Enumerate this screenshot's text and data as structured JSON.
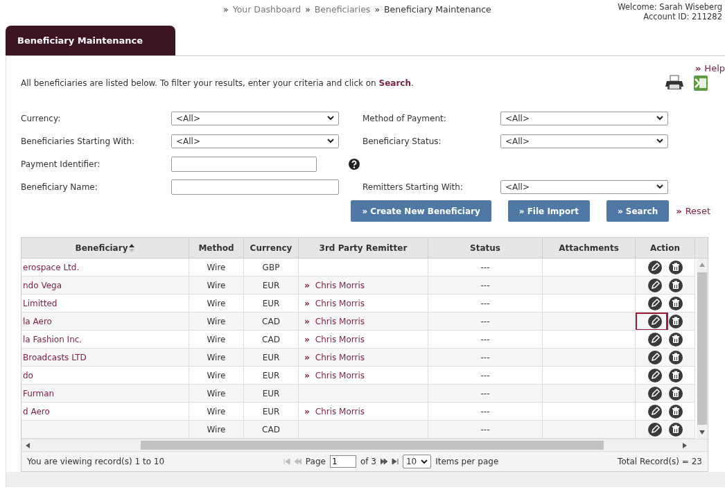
{
  "breadcrumbs": [
    {
      "separator": "»",
      "label": "Your Dashboard",
      "current": false
    },
    {
      "separator": "»",
      "label": "Beneficiaries",
      "current": false
    },
    {
      "separator": "»",
      "label": "Beneficiary Maintenance",
      "current": true
    }
  ],
  "user": {
    "welcome": "Welcome: Sarah Wiseberg",
    "account": "Account ID: 211282"
  },
  "tab": {
    "label": "Beneficiary Maintenance",
    "selected": true
  },
  "help_link": {
    "marker": "»",
    "label": "Help"
  },
  "intro": "All beneficiaries are listed below. To filter your results, enter your criteria and click on **Search**.",
  "filter_rows": [
    [
      {
        "kind": "select",
        "label": "Currency:",
        "value": "<All>"
      },
      {
        "kind": "select",
        "label": "Method of Payment:",
        "value": "<All>"
      }
    ],
    [
      {
        "kind": "select",
        "label": "Beneficiaries Starting With:",
        "value": "<All>"
      },
      {
        "kind": "select",
        "label": "Beneficiary Status:",
        "value": "<All>"
      }
    ],
    [
      {
        "kind": "text_help",
        "label": "Payment Identifier:"
      }
    ],
    [
      {
        "kind": "text",
        "label": "Beneficiary Name:"
      },
      {
        "kind": "select",
        "label": "Remitters Starting With:",
        "value": "<All>"
      }
    ]
  ],
  "buttons": [
    {
      "label": "» Create New Beneficiary"
    },
    {
      "label": "» File Import"
    },
    {
      "label": "» Search"
    }
  ],
  "reset_link": {
    "marker": "»",
    "label": "Reset"
  },
  "table": {
    "columns": [
      {
        "label": "Beneficiary",
        "sort_ascending": true
      },
      {
        "label": "Method"
      },
      {
        "label": "Currency"
      },
      {
        "label": "3rd Party Remitter"
      },
      {
        "label": "Status"
      },
      {
        "label": "Attachments"
      },
      {
        "label": "Action"
      }
    ],
    "rows": [
      {
        "beneficiary": "erospace Ltd.",
        "method": "Wire",
        "currency": "GBP",
        "status": "---",
        "edit_highlighted": false
      },
      {
        "beneficiary": "ndo Vega",
        "method": "Wire",
        "currency": "EUR",
        "remitter": {
          "marker": "»",
          "name": "Chris Morris"
        },
        "status": "---",
        "edit_highlighted": false
      },
      {
        "beneficiary": "Limitted",
        "method": "Wire",
        "currency": "EUR",
        "remitter": {
          "marker": "»",
          "name": "Chris Morris"
        },
        "status": "---",
        "edit_highlighted": false
      },
      {
        "beneficiary": "la Aero",
        "method": "Wire",
        "currency": "CAD",
        "remitter": {
          "marker": "»",
          "name": "Chris Morris"
        },
        "status": "---",
        "edit_highlighted": true
      },
      {
        "beneficiary": "la Fashion Inc.",
        "method": "Wire",
        "currency": "CAD",
        "remitter": {
          "marker": "»",
          "name": "Chris Morris"
        },
        "status": "---",
        "edit_highlighted": false
      },
      {
        "beneficiary": "Broadcasts LTD",
        "method": "Wire",
        "currency": "EUR",
        "remitter": {
          "marker": "»",
          "name": "Chris Morris"
        },
        "status": "---",
        "edit_highlighted": false
      },
      {
        "beneficiary": "do",
        "method": "Wire",
        "currency": "EUR",
        "remitter": {
          "marker": "»",
          "name": "Chris Morris"
        },
        "status": "---",
        "edit_highlighted": false
      },
      {
        "beneficiary": "Furman",
        "method": "Wire",
        "currency": "EUR",
        "status": "---",
        "edit_highlighted": false
      },
      {
        "beneficiary": "d Aero",
        "method": "Wire",
        "currency": "EUR",
        "remitter": {
          "marker": "»",
          "name": "Chris Morris"
        },
        "status": "---",
        "edit_highlighted": false
      },
      {
        "method": "Wire",
        "currency": "CAD",
        "status": "---",
        "edit_highlighted": false
      }
    ]
  },
  "footer": {
    "viewing": "You are viewing record(s) 1 to 10",
    "nav": [
      {
        "kind": "first",
        "disabled": true
      },
      {
        "kind": "prev",
        "disabled": true
      },
      {
        "kind": "next",
        "disabled": false
      },
      {
        "kind": "last",
        "disabled": false
      }
    ],
    "page_label": "Page",
    "page_value": "1",
    "of_label": "of 3",
    "page_size": "10",
    "page_size_label": "Items per page",
    "total": "Total Record(s) = 23"
  }
}
